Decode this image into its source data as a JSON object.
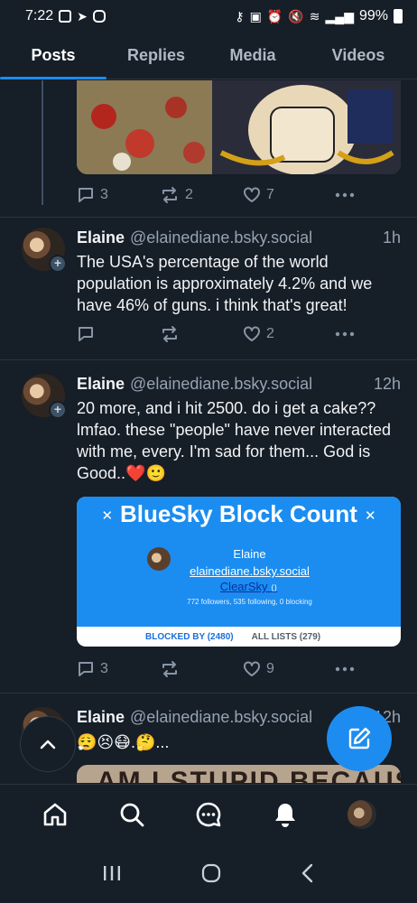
{
  "status_bar": {
    "time": "7:22",
    "battery": "99%",
    "left_icons": [
      "gallery-icon",
      "telegram-icon",
      "instagram-icon"
    ],
    "right_icons": [
      "key-icon",
      "nfc-icon",
      "alarm-icon",
      "mute-icon",
      "wifi-icon",
      "signal-icon",
      "battery-icon"
    ]
  },
  "tabs": [
    {
      "label": "Posts",
      "active": true
    },
    {
      "label": "Replies",
      "active": false
    },
    {
      "label": "Media",
      "active": false
    },
    {
      "label": "Videos",
      "active": false
    }
  ],
  "posts": [
    {
      "actions": {
        "replies": "3",
        "reposts": "2",
        "likes": "7"
      }
    },
    {
      "name": "Elaine",
      "handle": "@elainediane.bsky.social",
      "time": "1h",
      "text": "The USA's percentage of the world population is approximately 4.2% and we have 46% of guns. i think that's great!",
      "actions": {
        "replies": "",
        "reposts": "",
        "likes": "2"
      }
    },
    {
      "name": "Elaine",
      "handle": "@elainediane.bsky.social",
      "time": "12h",
      "text": "20 more, and i hit 2500. do i get a cake?? lmfao. these \"people\" have never interacted with me, every. I'm sad for them... God is Good..❤️🙂",
      "embed": {
        "title": "BlueSky Block Count",
        "title_icon": "✕",
        "profile_name": "Elaine",
        "profile_handle": "elainediane.bsky.social",
        "link_text": "ClearSky",
        "link_suffix": "⟨⟩",
        "stats": "772 followers, 535 following, 0 blocking",
        "tab_blocked": "BLOCKED BY (2480)",
        "tab_lists": "ALL LISTS (279)"
      },
      "actions": {
        "replies": "3",
        "reposts": "",
        "likes": "9"
      }
    },
    {
      "name": "Elaine",
      "handle": "@elainediane.bsky.social",
      "time": "12h",
      "text": "😮‍💨😣😷.🤔...",
      "image_text": "AM I STUPID BECAUSE"
    }
  ],
  "bottom_nav": [
    "home-icon",
    "search-icon",
    "chat-icon",
    "notifications-icon",
    "profile-avatar"
  ],
  "colors": {
    "background": "#161e27",
    "accent": "#1d8cf0",
    "muted": "#8796a7"
  }
}
